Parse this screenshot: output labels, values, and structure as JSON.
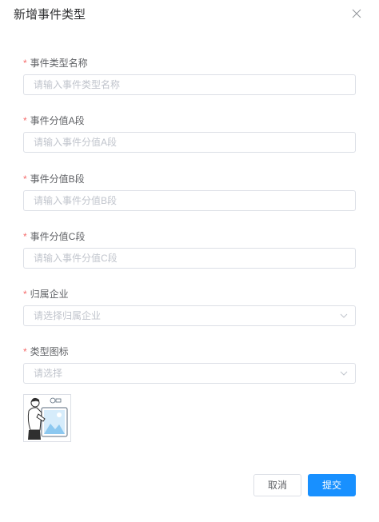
{
  "dialog": {
    "title": "新增事件类型"
  },
  "fields": [
    {
      "label": "事件类型名称",
      "required_mark": "*",
      "placeholder": "请输入事件类型名称"
    },
    {
      "label": "事件分值A段",
      "required_mark": "*",
      "placeholder": "请输入事件分值A段"
    },
    {
      "label": "事件分值B段",
      "required_mark": "*",
      "placeholder": "请输入事件分值B段"
    },
    {
      "label": "事件分值C段",
      "required_mark": "*",
      "placeholder": "请输入事件分值C段"
    },
    {
      "label": "归属企业",
      "required_mark": "*",
      "placeholder": "请选择归属企业"
    },
    {
      "label": "类型图标",
      "required_mark": "*",
      "placeholder": "请选择"
    }
  ],
  "icons": {
    "close": "close-icon",
    "select_arrow": "chevron-down-icon",
    "thumbnail": "image-placeholder-icon"
  },
  "colors": {
    "primary": "#1890ff",
    "required": "#f56c6c",
    "border": "#dcdfe6",
    "placeholder": "#c0c4cc"
  },
  "footer": {
    "cancel_label": "取消",
    "submit_label": "提交"
  }
}
